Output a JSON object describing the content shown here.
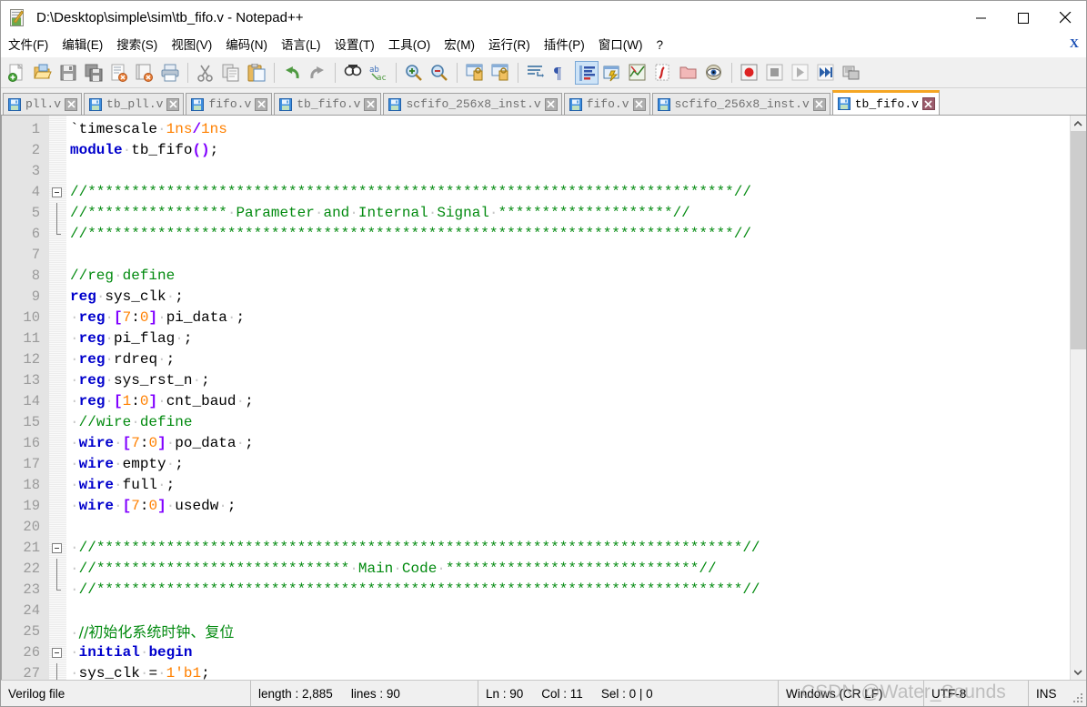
{
  "window": {
    "title": "D:\\Desktop\\simple\\sim\\tb_fifo.v - Notepad++",
    "icon": "notepad-plus-plus-icon",
    "minimize_label": "—",
    "maximize_label": "□",
    "close_label": "✕"
  },
  "menu": {
    "items": [
      {
        "label": "文件(F)",
        "name": "menu-file"
      },
      {
        "label": "编辑(E)",
        "name": "menu-edit"
      },
      {
        "label": "搜索(S)",
        "name": "menu-search"
      },
      {
        "label": "视图(V)",
        "name": "menu-view"
      },
      {
        "label": "编码(N)",
        "name": "menu-encoding"
      },
      {
        "label": "语言(L)",
        "name": "menu-language"
      },
      {
        "label": "设置(T)",
        "name": "menu-settings"
      },
      {
        "label": "工具(O)",
        "name": "menu-tools"
      },
      {
        "label": "宏(M)",
        "name": "menu-macro"
      },
      {
        "label": "运行(R)",
        "name": "menu-run"
      },
      {
        "label": "插件(P)",
        "name": "menu-plugins"
      },
      {
        "label": "窗口(W)",
        "name": "menu-window"
      },
      {
        "label": "?",
        "name": "menu-help"
      }
    ],
    "close_doc_label": "X"
  },
  "toolbar": {
    "buttons": [
      {
        "name": "new-file-icon",
        "sep_after": false
      },
      {
        "name": "open-file-icon",
        "sep_after": false
      },
      {
        "name": "save-icon",
        "sep_after": false
      },
      {
        "name": "save-all-icon",
        "sep_after": false
      },
      {
        "name": "close-file-icon",
        "sep_after": false
      },
      {
        "name": "close-all-files-icon",
        "sep_after": false
      },
      {
        "name": "print-icon",
        "sep_after": true
      },
      {
        "name": "cut-icon",
        "sep_after": false
      },
      {
        "name": "copy-icon",
        "sep_after": false
      },
      {
        "name": "paste-icon",
        "sep_after": true
      },
      {
        "name": "undo-icon",
        "sep_after": false
      },
      {
        "name": "redo-icon",
        "sep_after": true
      },
      {
        "name": "find-icon",
        "sep_after": false
      },
      {
        "name": "replace-icon",
        "sep_after": true
      },
      {
        "name": "zoom-in-icon",
        "sep_after": false
      },
      {
        "name": "zoom-out-icon",
        "sep_after": true
      },
      {
        "name": "sync-vertical-scroll-icon",
        "sep_after": false
      },
      {
        "name": "sync-horizontal-scroll-icon",
        "sep_after": true
      },
      {
        "name": "word-wrap-icon",
        "sep_after": false
      },
      {
        "name": "show-all-characters-icon",
        "sep_after": false
      },
      {
        "name": "indent-guide-icon",
        "sep_after": false
      },
      {
        "name": "user-defined-language-icon",
        "sep_after": false
      },
      {
        "name": "document-map-icon",
        "sep_after": false
      },
      {
        "name": "function-list-icon",
        "sep_after": false
      },
      {
        "name": "folder-as-workspace-icon",
        "sep_after": false
      },
      {
        "name": "monitoring-icon",
        "sep_after": true
      },
      {
        "name": "macro-record-icon",
        "sep_after": false
      },
      {
        "name": "macro-stop-icon",
        "sep_after": false
      },
      {
        "name": "macro-playback-icon",
        "sep_after": false
      },
      {
        "name": "macro-run-multiple-icon",
        "sep_after": false
      },
      {
        "name": "macro-save-icon",
        "sep_after": false
      }
    ]
  },
  "tabs": [
    {
      "label": "pll.v",
      "active": false
    },
    {
      "label": "tb_pll.v",
      "active": false
    },
    {
      "label": "fifo.v",
      "active": false
    },
    {
      "label": "tb_fifo.v",
      "active": false
    },
    {
      "label": "scfifo_256x8_inst.v",
      "active": false
    },
    {
      "label": "fifo.v",
      "active": false
    },
    {
      "label": "scfifo_256x8_inst.v",
      "active": false
    },
    {
      "label": "tb_fifo.v",
      "active": true
    }
  ],
  "editor": {
    "first_line": 1,
    "last_line": 27,
    "lines": [
      {
        "n": 1,
        "fold": "none",
        "tokens": [
          {
            "t": "`timescale",
            "c": "pl"
          },
          {
            "t": "·",
            "c": "ws"
          },
          {
            "t": "1ns",
            "c": "num"
          },
          {
            "t": "/",
            "c": "op"
          },
          {
            "t": "1ns",
            "c": "num"
          }
        ]
      },
      {
        "n": 2,
        "fold": "none",
        "tokens": [
          {
            "t": "module",
            "c": "k"
          },
          {
            "t": "·",
            "c": "ws"
          },
          {
            "t": "tb_fifo",
            "c": "pl"
          },
          {
            "t": "()",
            "c": "op"
          },
          {
            "t": ";",
            "c": "pl"
          }
        ]
      },
      {
        "n": 3,
        "fold": "none",
        "tokens": []
      },
      {
        "n": 4,
        "fold": "start",
        "tokens": [
          {
            "t": "//**************************************************************************//",
            "c": "cm"
          }
        ]
      },
      {
        "n": 5,
        "fold": "mid",
        "tokens": [
          {
            "t": "//****************",
            "c": "cm"
          },
          {
            "t": "·",
            "c": "ws"
          },
          {
            "t": "Parameter",
            "c": "cm"
          },
          {
            "t": "·",
            "c": "ws"
          },
          {
            "t": "and",
            "c": "cm"
          },
          {
            "t": "·",
            "c": "ws"
          },
          {
            "t": "Internal",
            "c": "cm"
          },
          {
            "t": "·",
            "c": "ws"
          },
          {
            "t": "Signal",
            "c": "cm"
          },
          {
            "t": "·",
            "c": "ws"
          },
          {
            "t": "********************",
            "c": "cm"
          },
          {
            "t": "//",
            "c": "cm"
          }
        ]
      },
      {
        "n": 6,
        "fold": "end",
        "tokens": [
          {
            "t": "//**************************************************************************//",
            "c": "cm"
          }
        ]
      },
      {
        "n": 7,
        "fold": "none",
        "tokens": []
      },
      {
        "n": 8,
        "fold": "none",
        "tokens": [
          {
            "t": "//reg",
            "c": "cm"
          },
          {
            "t": "·",
            "c": "ws"
          },
          {
            "t": "define",
            "c": "cm"
          }
        ]
      },
      {
        "n": 9,
        "fold": "none",
        "tokens": [
          {
            "t": "reg",
            "c": "k"
          },
          {
            "t": "·",
            "c": "ws"
          },
          {
            "t": "sys_clk",
            "c": "pl"
          },
          {
            "t": "·",
            "c": "ws"
          },
          {
            "t": ";",
            "c": "pl"
          }
        ]
      },
      {
        "n": 10,
        "fold": "none",
        "tokens": [
          {
            "t": "·",
            "c": "ws"
          },
          {
            "t": "reg",
            "c": "k"
          },
          {
            "t": "·",
            "c": "ws"
          },
          {
            "t": "[",
            "c": "op"
          },
          {
            "t": "7",
            "c": "num"
          },
          {
            "t": ":",
            "c": "pl"
          },
          {
            "t": "0",
            "c": "num"
          },
          {
            "t": "]",
            "c": "op"
          },
          {
            "t": "·",
            "c": "ws"
          },
          {
            "t": "pi_data",
            "c": "pl"
          },
          {
            "t": "·",
            "c": "ws"
          },
          {
            "t": ";",
            "c": "pl"
          }
        ]
      },
      {
        "n": 11,
        "fold": "none",
        "tokens": [
          {
            "t": "·",
            "c": "ws"
          },
          {
            "t": "reg",
            "c": "k"
          },
          {
            "t": "·",
            "c": "ws"
          },
          {
            "t": "pi_flag",
            "c": "pl"
          },
          {
            "t": "·",
            "c": "ws"
          },
          {
            "t": ";",
            "c": "pl"
          }
        ]
      },
      {
        "n": 12,
        "fold": "none",
        "tokens": [
          {
            "t": "·",
            "c": "ws"
          },
          {
            "t": "reg",
            "c": "k"
          },
          {
            "t": "·",
            "c": "ws"
          },
          {
            "t": "rdreq",
            "c": "pl"
          },
          {
            "t": "·",
            "c": "ws"
          },
          {
            "t": ";",
            "c": "pl"
          }
        ]
      },
      {
        "n": 13,
        "fold": "none",
        "tokens": [
          {
            "t": "·",
            "c": "ws"
          },
          {
            "t": "reg",
            "c": "k"
          },
          {
            "t": "·",
            "c": "ws"
          },
          {
            "t": "sys_rst_n",
            "c": "pl"
          },
          {
            "t": "·",
            "c": "ws"
          },
          {
            "t": ";",
            "c": "pl"
          }
        ]
      },
      {
        "n": 14,
        "fold": "none",
        "tokens": [
          {
            "t": "·",
            "c": "ws"
          },
          {
            "t": "reg",
            "c": "k"
          },
          {
            "t": "·",
            "c": "ws"
          },
          {
            "t": "[",
            "c": "op"
          },
          {
            "t": "1",
            "c": "num"
          },
          {
            "t": ":",
            "c": "pl"
          },
          {
            "t": "0",
            "c": "num"
          },
          {
            "t": "]",
            "c": "op"
          },
          {
            "t": "·",
            "c": "ws"
          },
          {
            "t": "cnt_baud",
            "c": "pl"
          },
          {
            "t": "·",
            "c": "ws"
          },
          {
            "t": ";",
            "c": "pl"
          }
        ]
      },
      {
        "n": 15,
        "fold": "none",
        "tokens": [
          {
            "t": "·",
            "c": "ws"
          },
          {
            "t": "//wire",
            "c": "cm"
          },
          {
            "t": "·",
            "c": "ws"
          },
          {
            "t": "define",
            "c": "cm"
          }
        ]
      },
      {
        "n": 16,
        "fold": "none",
        "tokens": [
          {
            "t": "·",
            "c": "ws"
          },
          {
            "t": "wire",
            "c": "k"
          },
          {
            "t": "·",
            "c": "ws"
          },
          {
            "t": "[",
            "c": "op"
          },
          {
            "t": "7",
            "c": "num"
          },
          {
            "t": ":",
            "c": "pl"
          },
          {
            "t": "0",
            "c": "num"
          },
          {
            "t": "]",
            "c": "op"
          },
          {
            "t": "·",
            "c": "ws"
          },
          {
            "t": "po_data",
            "c": "pl"
          },
          {
            "t": "·",
            "c": "ws"
          },
          {
            "t": ";",
            "c": "pl"
          }
        ]
      },
      {
        "n": 17,
        "fold": "none",
        "tokens": [
          {
            "t": "·",
            "c": "ws"
          },
          {
            "t": "wire",
            "c": "k"
          },
          {
            "t": "·",
            "c": "ws"
          },
          {
            "t": "empty",
            "c": "pl"
          },
          {
            "t": "·",
            "c": "ws"
          },
          {
            "t": ";",
            "c": "pl"
          }
        ]
      },
      {
        "n": 18,
        "fold": "none",
        "tokens": [
          {
            "t": "·",
            "c": "ws"
          },
          {
            "t": "wire",
            "c": "k"
          },
          {
            "t": "·",
            "c": "ws"
          },
          {
            "t": "full",
            "c": "pl"
          },
          {
            "t": "·",
            "c": "ws"
          },
          {
            "t": ";",
            "c": "pl"
          }
        ]
      },
      {
        "n": 19,
        "fold": "none",
        "tokens": [
          {
            "t": "·",
            "c": "ws"
          },
          {
            "t": "wire",
            "c": "k"
          },
          {
            "t": "·",
            "c": "ws"
          },
          {
            "t": "[",
            "c": "op"
          },
          {
            "t": "7",
            "c": "num"
          },
          {
            "t": ":",
            "c": "pl"
          },
          {
            "t": "0",
            "c": "num"
          },
          {
            "t": "]",
            "c": "op"
          },
          {
            "t": "·",
            "c": "ws"
          },
          {
            "t": "usedw",
            "c": "pl"
          },
          {
            "t": "·",
            "c": "ws"
          },
          {
            "t": ";",
            "c": "pl"
          }
        ]
      },
      {
        "n": 20,
        "fold": "none",
        "tokens": []
      },
      {
        "n": 21,
        "fold": "start",
        "tokens": [
          {
            "t": "·",
            "c": "ws"
          },
          {
            "t": "//**************************************************************************//",
            "c": "cm"
          }
        ]
      },
      {
        "n": 22,
        "fold": "mid",
        "tokens": [
          {
            "t": "·",
            "c": "ws"
          },
          {
            "t": "//*****************************",
            "c": "cm"
          },
          {
            "t": "·",
            "c": "ws"
          },
          {
            "t": "Main",
            "c": "cm"
          },
          {
            "t": "·",
            "c": "ws"
          },
          {
            "t": "Code",
            "c": "cm"
          },
          {
            "t": "·",
            "c": "ws"
          },
          {
            "t": "*****************************",
            "c": "cm"
          },
          {
            "t": "//",
            "c": "cm"
          }
        ]
      },
      {
        "n": 23,
        "fold": "end",
        "tokens": [
          {
            "t": "·",
            "c": "ws"
          },
          {
            "t": "//**************************************************************************//",
            "c": "cm"
          }
        ]
      },
      {
        "n": 24,
        "fold": "none",
        "tokens": []
      },
      {
        "n": 25,
        "fold": "none",
        "tokens": [
          {
            "t": "·",
            "c": "ws"
          },
          {
            "t": "//初始化系统时钟、复位",
            "c": "cm cjk"
          }
        ]
      },
      {
        "n": 26,
        "fold": "start",
        "tokens": [
          {
            "t": "·",
            "c": "ws"
          },
          {
            "t": "initial",
            "c": "k"
          },
          {
            "t": "·",
            "c": "ws"
          },
          {
            "t": "begin",
            "c": "k"
          }
        ]
      },
      {
        "n": 27,
        "fold": "mid",
        "tokens": [
          {
            "t": "·",
            "c": "ws"
          },
          {
            "t": "sys_clk",
            "c": "pl"
          },
          {
            "t": "·",
            "c": "ws"
          },
          {
            "t": "=",
            "c": "pl"
          },
          {
            "t": "·",
            "c": "ws"
          },
          {
            "t": "1",
            "c": "num"
          },
          {
            "t": "'b1",
            "c": "num"
          },
          {
            "t": ";",
            "c": "pl"
          }
        ]
      }
    ]
  },
  "scrollbar": {
    "up_arrow": "▲",
    "down_arrow": "▼"
  },
  "status": {
    "file_type": "Verilog file",
    "length_label": "length : 2,885",
    "lines_label": "lines : 90",
    "ln": "Ln : 90",
    "col": "Col : 11",
    "sel": "Sel : 0 | 0",
    "eol": "Windows (CR LF)",
    "encoding": "UTF-8",
    "insert_mode": "INS"
  },
  "watermark": "CSDN @Water_Sounds",
  "colors": {
    "accent_tab": "#f5a623",
    "keyword": "#0000cc",
    "comment": "#028a0f",
    "number": "#ff8000",
    "operator": "#8000ff",
    "gutter_bg": "#e4e4e4",
    "titlebar_bg": "#ffffff",
    "toolbar_bg": "#f0f0f0"
  }
}
